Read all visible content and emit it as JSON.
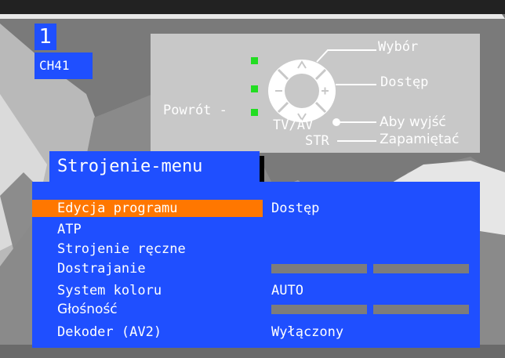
{
  "channel": {
    "number": "1",
    "name": "CH41"
  },
  "help": {
    "select_label": "Wybór",
    "access_label": "Dostęp",
    "back_label": "Powrót  -",
    "exit_source_label": "TV/AV",
    "exit_label": "Aby wyjść",
    "store_source_label": "STR",
    "store_label": "Zapamiętać"
  },
  "menu": {
    "title": "Strojenie-menu",
    "items": [
      {
        "label": "Edycja programu",
        "value": "Dostęp"
      },
      {
        "label": "ATP",
        "value": ""
      },
      {
        "label": "Strojenie ręczne",
        "value": ""
      },
      {
        "label": "Dostrajanie",
        "value": ""
      },
      {
        "label": "System koloru",
        "value": "AUTO"
      },
      {
        "label": "Głośność",
        "value": ""
      },
      {
        "label": "Dekoder (AV2)",
        "value": "Wyłączony"
      }
    ]
  },
  "colors": {
    "panel_blue": "#1f4fff",
    "highlight_orange": "#ff7700",
    "led_green": "#22dd22",
    "help_gray": "#c8c8c8"
  },
  "icons": {
    "remote": "navigation-ring-icon",
    "exit": "dot-arrow-icon"
  }
}
